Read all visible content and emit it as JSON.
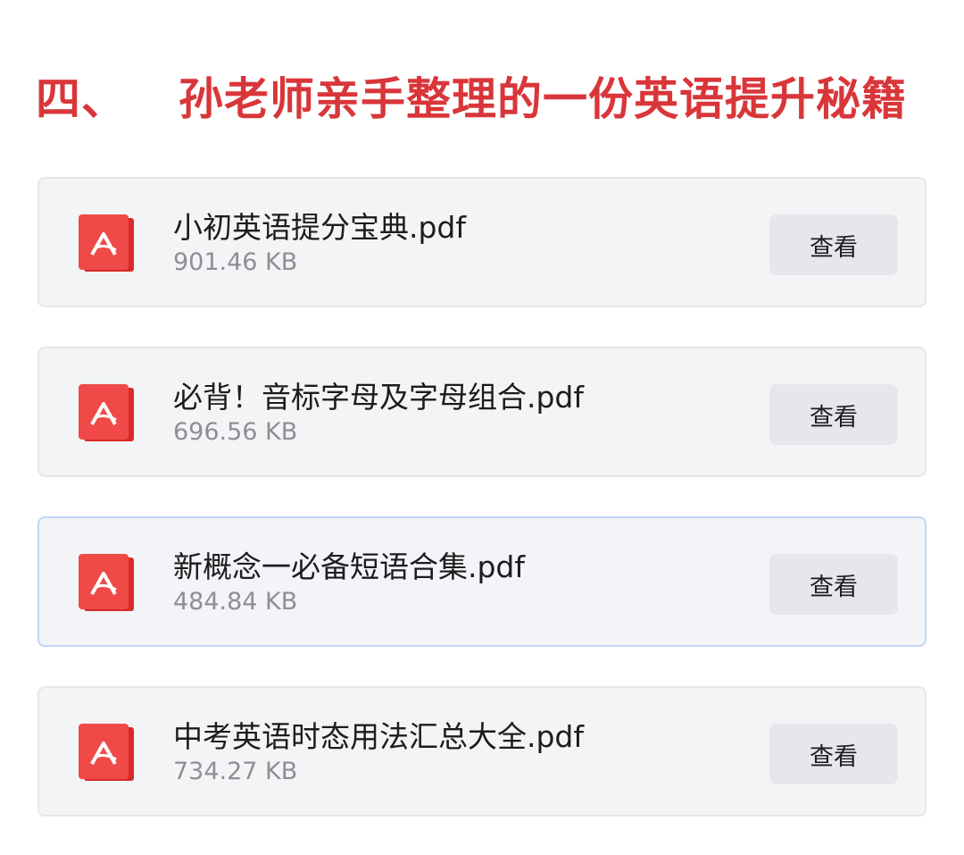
{
  "section": {
    "number": "四、",
    "title": "孙老师亲手整理的一份英语提升秘籍",
    "color": "#d9363a"
  },
  "files": [
    {
      "name": "小初英语提分宝典.pdf",
      "size": "901.46 KB",
      "action": "查看",
      "icon": "pdf-file-icon"
    },
    {
      "name": "必背！音标字母及字母组合.pdf",
      "size": "696.56 KB",
      "action": "查看",
      "icon": "pdf-file-icon"
    },
    {
      "name": "新概念一必备短语合集.pdf",
      "size": "484.84 KB",
      "action": "查看",
      "icon": "pdf-file-icon"
    },
    {
      "name": "中考英语时态用法汇总大全.pdf",
      "size": "734.27 KB",
      "action": "查看",
      "icon": "pdf-file-icon"
    }
  ],
  "colors": {
    "pdf_icon": "#ef4a47",
    "card_background": "#f3f4f6",
    "button_background": "#e5e7ea",
    "selected_border": "#c2d6f6"
  }
}
